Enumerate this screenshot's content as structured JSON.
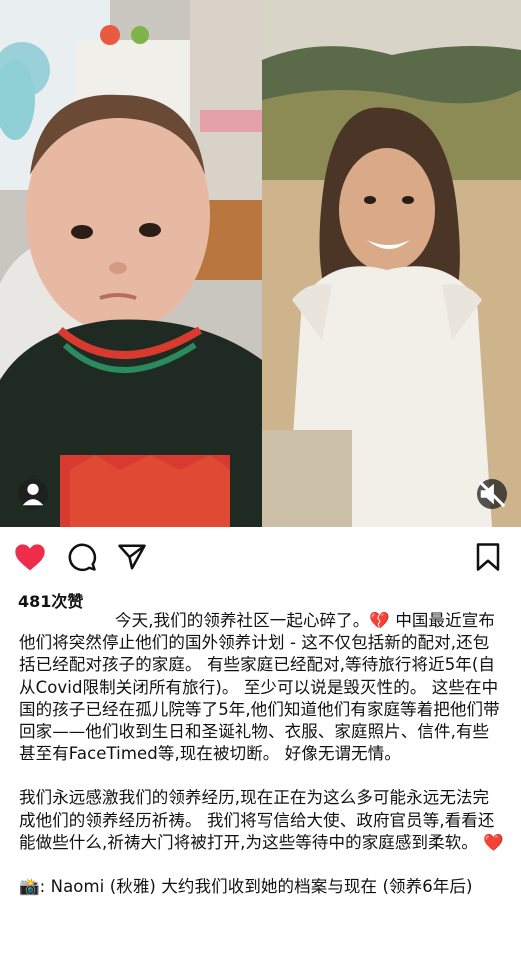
{
  "post": {
    "likes_label": "481次赞",
    "caption": {
      "p1": "今天,我们的领养社区一起心碎了。💔 中国最近宣布他们将突然停止他们的国外领养计划 - 这不仅包括新的配对,还包括已经配对孩子的家庭。 有些家庭已经配对,等待旅行将近5年(自从Covid限制关闭所有旅行)。 至少可以说是毁灭性的。 这些在中国的孩子已经在孤儿院等了5年,他们知道他们有家庭等着把他们带回家——他们收到生日和圣诞礼物、衣服、家庭照片、信件,有些甚至有FaceTimed等,现在被切断。 好像无谓无情。",
      "p2": "我们永远感激我们的领养经历,现在正在为这么多可能永远无法完成他们的领养经历祈祷。 我们将写信给大使、政府官员等,看看还能做些什么,祈祷大门将被打开,为这些等待中的家庭感到柔软。 ❤️",
      "p3": "📸: Naomi (秋雅) 大约我们收到她的档案与现在 (领养6年后)"
    }
  },
  "icons": {
    "like": "heart-filled-icon",
    "comment": "comment-bubble-icon",
    "share": "paper-plane-icon",
    "save": "bookmark-icon",
    "tag": "person-tag-icon",
    "mute": "muted-speaker-icon"
  },
  "colors": {
    "like_red": "#ed2d49",
    "text": "#111111"
  }
}
